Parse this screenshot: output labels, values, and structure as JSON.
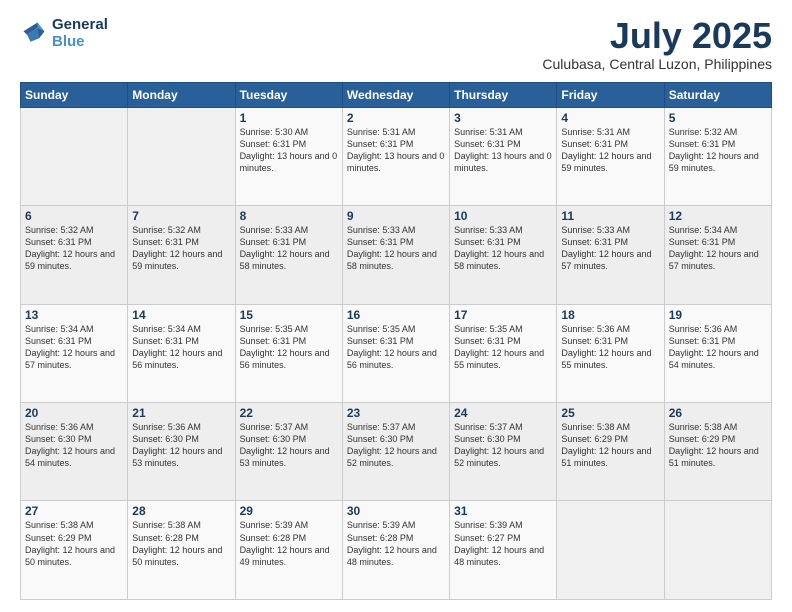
{
  "logo": {
    "line1": "General",
    "line2": "Blue"
  },
  "header": {
    "title": "July 2025",
    "subtitle": "Culubasa, Central Luzon, Philippines"
  },
  "weekdays": [
    "Sunday",
    "Monday",
    "Tuesday",
    "Wednesday",
    "Thursday",
    "Friday",
    "Saturday"
  ],
  "weeks": [
    [
      {
        "day": "",
        "sunrise": "",
        "sunset": "",
        "daylight": ""
      },
      {
        "day": "",
        "sunrise": "",
        "sunset": "",
        "daylight": ""
      },
      {
        "day": "1",
        "sunrise": "5:30 AM",
        "sunset": "6:31 PM",
        "daylight": "13 hours and 0 minutes."
      },
      {
        "day": "2",
        "sunrise": "5:31 AM",
        "sunset": "6:31 PM",
        "daylight": "13 hours and 0 minutes."
      },
      {
        "day": "3",
        "sunrise": "5:31 AM",
        "sunset": "6:31 PM",
        "daylight": "13 hours and 0 minutes."
      },
      {
        "day": "4",
        "sunrise": "5:31 AM",
        "sunset": "6:31 PM",
        "daylight": "12 hours and 59 minutes."
      },
      {
        "day": "5",
        "sunrise": "5:32 AM",
        "sunset": "6:31 PM",
        "daylight": "12 hours and 59 minutes."
      }
    ],
    [
      {
        "day": "6",
        "sunrise": "5:32 AM",
        "sunset": "6:31 PM",
        "daylight": "12 hours and 59 minutes."
      },
      {
        "day": "7",
        "sunrise": "5:32 AM",
        "sunset": "6:31 PM",
        "daylight": "12 hours and 59 minutes."
      },
      {
        "day": "8",
        "sunrise": "5:33 AM",
        "sunset": "6:31 PM",
        "daylight": "12 hours and 58 minutes."
      },
      {
        "day": "9",
        "sunrise": "5:33 AM",
        "sunset": "6:31 PM",
        "daylight": "12 hours and 58 minutes."
      },
      {
        "day": "10",
        "sunrise": "5:33 AM",
        "sunset": "6:31 PM",
        "daylight": "12 hours and 58 minutes."
      },
      {
        "day": "11",
        "sunrise": "5:33 AM",
        "sunset": "6:31 PM",
        "daylight": "12 hours and 57 minutes."
      },
      {
        "day": "12",
        "sunrise": "5:34 AM",
        "sunset": "6:31 PM",
        "daylight": "12 hours and 57 minutes."
      }
    ],
    [
      {
        "day": "13",
        "sunrise": "5:34 AM",
        "sunset": "6:31 PM",
        "daylight": "12 hours and 57 minutes."
      },
      {
        "day": "14",
        "sunrise": "5:34 AM",
        "sunset": "6:31 PM",
        "daylight": "12 hours and 56 minutes."
      },
      {
        "day": "15",
        "sunrise": "5:35 AM",
        "sunset": "6:31 PM",
        "daylight": "12 hours and 56 minutes."
      },
      {
        "day": "16",
        "sunrise": "5:35 AM",
        "sunset": "6:31 PM",
        "daylight": "12 hours and 56 minutes."
      },
      {
        "day": "17",
        "sunrise": "5:35 AM",
        "sunset": "6:31 PM",
        "daylight": "12 hours and 55 minutes."
      },
      {
        "day": "18",
        "sunrise": "5:36 AM",
        "sunset": "6:31 PM",
        "daylight": "12 hours and 55 minutes."
      },
      {
        "day": "19",
        "sunrise": "5:36 AM",
        "sunset": "6:31 PM",
        "daylight": "12 hours and 54 minutes."
      }
    ],
    [
      {
        "day": "20",
        "sunrise": "5:36 AM",
        "sunset": "6:30 PM",
        "daylight": "12 hours and 54 minutes."
      },
      {
        "day": "21",
        "sunrise": "5:36 AM",
        "sunset": "6:30 PM",
        "daylight": "12 hours and 53 minutes."
      },
      {
        "day": "22",
        "sunrise": "5:37 AM",
        "sunset": "6:30 PM",
        "daylight": "12 hours and 53 minutes."
      },
      {
        "day": "23",
        "sunrise": "5:37 AM",
        "sunset": "6:30 PM",
        "daylight": "12 hours and 52 minutes."
      },
      {
        "day": "24",
        "sunrise": "5:37 AM",
        "sunset": "6:30 PM",
        "daylight": "12 hours and 52 minutes."
      },
      {
        "day": "25",
        "sunrise": "5:38 AM",
        "sunset": "6:29 PM",
        "daylight": "12 hours and 51 minutes."
      },
      {
        "day": "26",
        "sunrise": "5:38 AM",
        "sunset": "6:29 PM",
        "daylight": "12 hours and 51 minutes."
      }
    ],
    [
      {
        "day": "27",
        "sunrise": "5:38 AM",
        "sunset": "6:29 PM",
        "daylight": "12 hours and 50 minutes."
      },
      {
        "day": "28",
        "sunrise": "5:38 AM",
        "sunset": "6:28 PM",
        "daylight": "12 hours and 50 minutes."
      },
      {
        "day": "29",
        "sunrise": "5:39 AM",
        "sunset": "6:28 PM",
        "daylight": "12 hours and 49 minutes."
      },
      {
        "day": "30",
        "sunrise": "5:39 AM",
        "sunset": "6:28 PM",
        "daylight": "12 hours and 48 minutes."
      },
      {
        "day": "31",
        "sunrise": "5:39 AM",
        "sunset": "6:27 PM",
        "daylight": "12 hours and 48 minutes."
      },
      {
        "day": "",
        "sunrise": "",
        "sunset": "",
        "daylight": ""
      },
      {
        "day": "",
        "sunrise": "",
        "sunset": "",
        "daylight": ""
      }
    ]
  ]
}
